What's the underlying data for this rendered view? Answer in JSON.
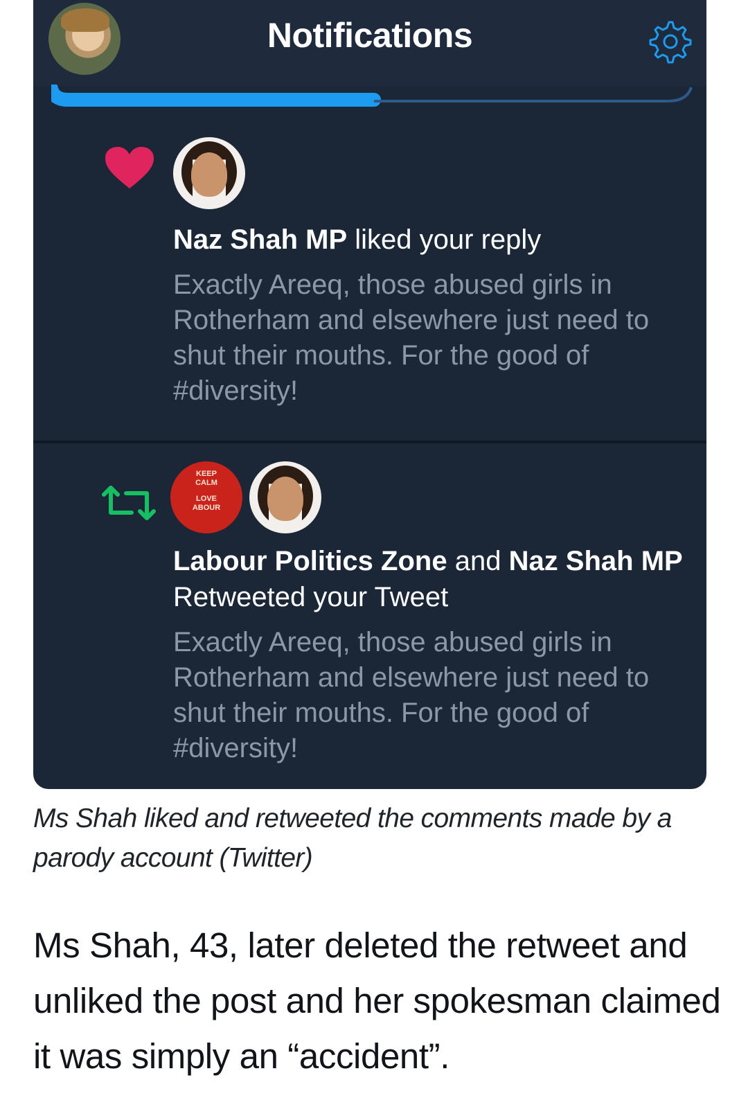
{
  "header": {
    "title": "Notifications"
  },
  "notifications": [
    {
      "type": "like",
      "icon": "heart-icon",
      "actor_bold": "Naz Shah MP",
      "action": " liked your reply",
      "text": "Exactly Areeq, those abused girls in Rotherham and elsewhere just need to shut their mouths. For the good of #diversity!"
    },
    {
      "type": "retweet",
      "icon": "retweet-icon",
      "actor1_bold": "Labour Politics Zone",
      "joiner": " and ",
      "actor2_bold": "Naz Shah MP",
      "action": " Retweeted your Tweet",
      "text": "Exactly Areeq, those abused girls in Rotherham and elsewhere just need to shut their mouths. For the good of #diversity!",
      "keep_calm_avatar_text": [
        "KEEP",
        "CALM",
        "LOVE",
        "ABOUR"
      ]
    }
  ],
  "caption": "Ms Shah liked and retweeted the comments made by a parody account (Twitter)",
  "article_text": "Ms Shah, 43, later deleted the retweet and unliked the post and her spokesman claimed it was simply an “accident”.",
  "colors": {
    "background": "#1b2737",
    "accent_blue": "#1d9bf0",
    "heart_red": "#e0245e",
    "retweet_green": "#17bf63"
  }
}
